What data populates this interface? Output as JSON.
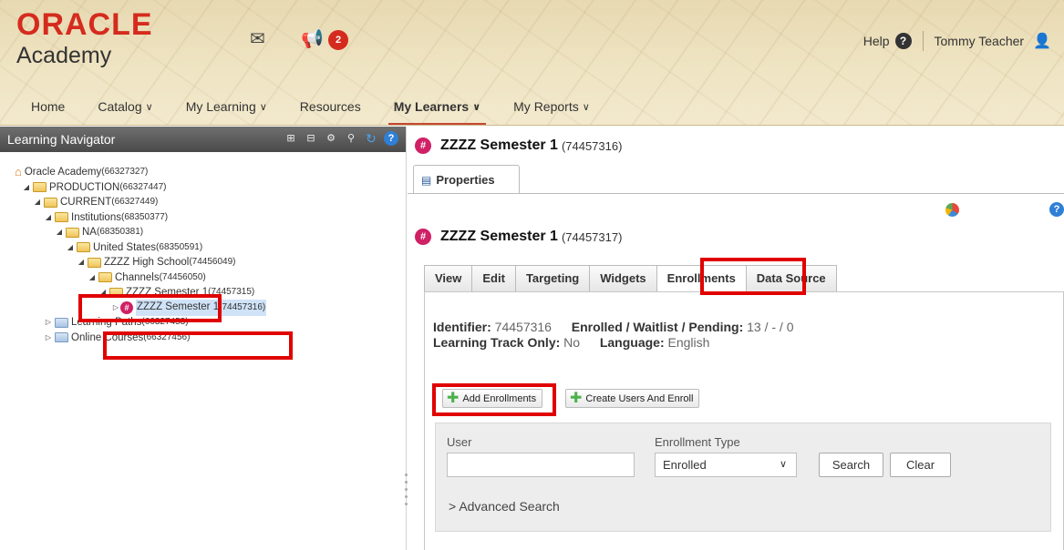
{
  "header": {
    "logo_oracle": "ORACLE",
    "logo_academy": "Academy",
    "notification_count": "2",
    "help_label": "Help",
    "user_name": "Tommy Teacher"
  },
  "nav": {
    "items": [
      {
        "label": "Home",
        "dropdown": false,
        "active": false
      },
      {
        "label": "Catalog",
        "dropdown": true,
        "active": false
      },
      {
        "label": "My Learning",
        "dropdown": true,
        "active": false
      },
      {
        "label": "Resources",
        "dropdown": false,
        "active": false
      },
      {
        "label": "My Learners",
        "dropdown": true,
        "active": true
      },
      {
        "label": "My Reports",
        "dropdown": true,
        "active": false
      }
    ]
  },
  "left_panel": {
    "title": "Learning Navigator",
    "tree": [
      {
        "label": "Oracle Academy",
        "code": "(66327327)"
      },
      {
        "label": "PRODUCTION",
        "code": "(66327447)"
      },
      {
        "label": "CURRENT",
        "code": "(66327449)"
      },
      {
        "label": "Institutions",
        "code": "(68350377)"
      },
      {
        "label": "NA",
        "code": "(68350381)"
      },
      {
        "label": "United States",
        "code": "(68350591)"
      },
      {
        "label": "ZZZZ High School",
        "code": "(74456049)"
      },
      {
        "label": "Channels",
        "code": "(74456050)"
      },
      {
        "label": "ZZZZ Semester 1",
        "code": "(74457315)"
      },
      {
        "label": "ZZZZ Semester 1",
        "code": "(74457316)"
      },
      {
        "label": "Learning Paths",
        "code": "(66327453)"
      },
      {
        "label": "Online Courses",
        "code": "(66327456)"
      }
    ]
  },
  "right_panel": {
    "title": "ZZZZ Semester 1",
    "title_code": "(74457316)",
    "properties_tab": "Properties",
    "inner_title": "ZZZZ Semester 1",
    "inner_code": "(74457317)",
    "tabs": [
      "View",
      "Edit",
      "Targeting",
      "Widgets",
      "Enrollments",
      "Data Source"
    ],
    "active_tab": "Enrollments",
    "info": {
      "identifier_label": "Identifier:",
      "identifier_value": "74457316",
      "enrolled_label": "Enrolled / Waitlist / Pending:",
      "enrolled_value": "13 / - / 0",
      "track_label": "Learning Track Only:",
      "track_value": "No",
      "language_label": "Language:",
      "language_value": "English"
    },
    "buttons": {
      "add_enrollments": "Add Enrollments",
      "create_users": "Create Users And Enroll"
    },
    "search": {
      "user_label": "User",
      "user_value": "",
      "type_label": "Enrollment Type",
      "type_value": "Enrolled",
      "search_btn": "Search",
      "clear_btn": "Clear",
      "advanced": "Advanced Search"
    }
  }
}
